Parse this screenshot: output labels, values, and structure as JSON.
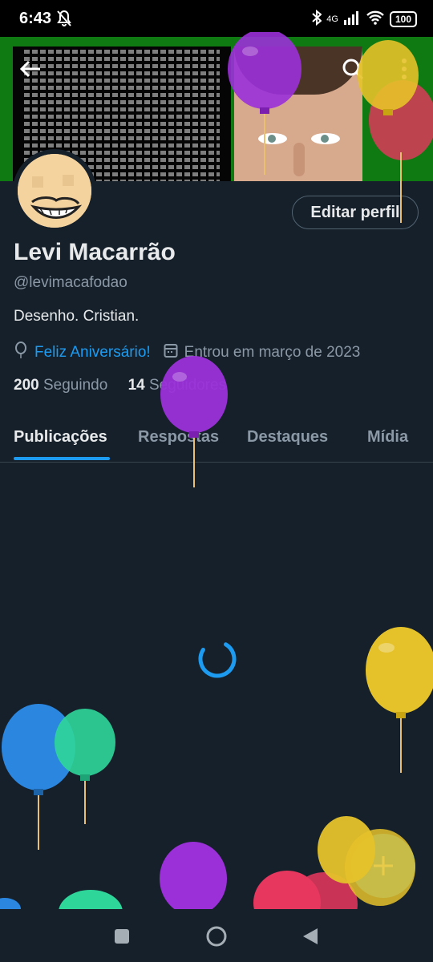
{
  "status_bar": {
    "time": "6:43",
    "network": "4G",
    "battery": "100",
    "icons": [
      "bell-off-icon",
      "bluetooth-icon",
      "signal-icon",
      "wifi-icon",
      "battery-icon"
    ]
  },
  "header_actions": [
    "back-arrow-icon",
    "search-icon",
    "more-vertical-icon"
  ],
  "profile": {
    "name": "Levi Macarrão",
    "handle": "@levimacafodao",
    "bio": "Desenho.  Cristian.",
    "birthday": "Feliz Aniversário!",
    "joined": "Entrou em março de 2023",
    "following_count": "200",
    "following_label": "Seguindo",
    "followers_count": "14",
    "followers_label": "Seguidores",
    "edit_button": "Editar perfil"
  },
  "tabs": [
    {
      "label": "Publicações",
      "active": true
    },
    {
      "label": "Respostas",
      "active": false
    },
    {
      "label": "Destaques",
      "active": false
    },
    {
      "label": "Mídia",
      "active": false
    }
  ],
  "feed": {
    "state": "loading"
  },
  "colors": {
    "background": "#15202b",
    "accent": "#1d9bf0",
    "muted_text": "#8b98a5",
    "banner_green": "#0f7a12"
  },
  "nav_bar": [
    "recents-square-icon",
    "home-circle-icon",
    "back-triangle-icon"
  ],
  "fab_icon": "plus-icon"
}
